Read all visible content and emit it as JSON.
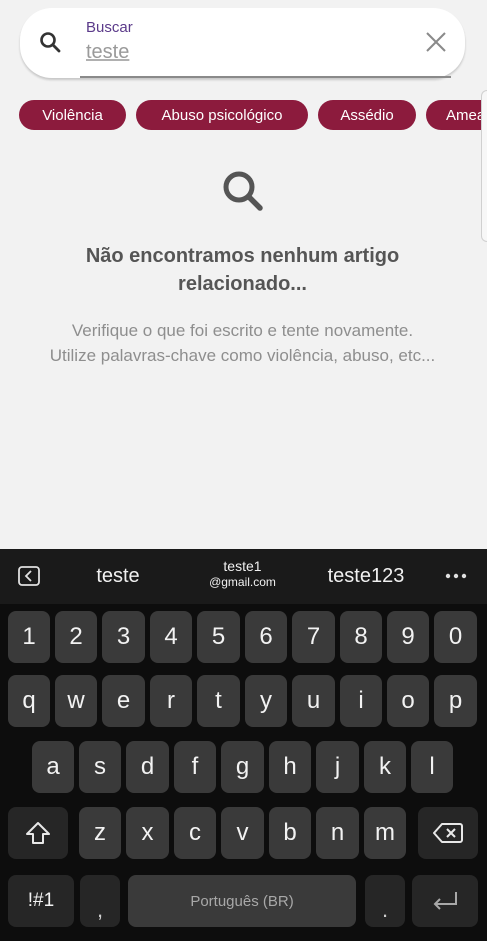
{
  "search": {
    "label": "Buscar",
    "value": "teste",
    "search_icon": "search-icon",
    "clear_icon": "close-icon"
  },
  "filters": [
    "Violência",
    "Abuso psicológico",
    "Assédio",
    "Amea"
  ],
  "empty_state": {
    "icon": "search-icon",
    "title_line1": "Não encontramos nenhum artigo",
    "title_line2": "relacionado...",
    "hint_line1": "Verifique o que foi escrito e tente novamente.",
    "hint_line2": "Utilize palavras-chave como violência, abuso, etc..."
  },
  "keyboard": {
    "suggestions": {
      "left": "teste",
      "middle_line1": "teste1",
      "middle_line2": "@gmail.com",
      "right": "teste123"
    },
    "rows": {
      "numbers": [
        "1",
        "2",
        "3",
        "4",
        "5",
        "6",
        "7",
        "8",
        "9",
        "0"
      ],
      "row1": [
        "q",
        "w",
        "e",
        "r",
        "t",
        "y",
        "u",
        "i",
        "o",
        "p"
      ],
      "row2": [
        "a",
        "s",
        "d",
        "f",
        "g",
        "h",
        "j",
        "k",
        "l"
      ],
      "row3": [
        "z",
        "x",
        "c",
        "v",
        "b",
        "n",
        "m"
      ]
    },
    "symbols_label": "!#1",
    "comma_label": ",",
    "space_label": "Português (BR)",
    "period_label": "."
  },
  "colors": {
    "chip_background": "#8c1b3d",
    "search_label": "#5b3a8a",
    "background": "#f2f2f2"
  }
}
